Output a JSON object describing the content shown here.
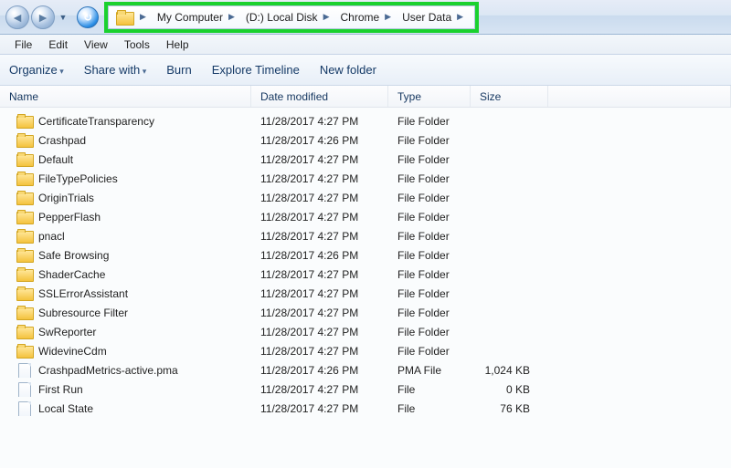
{
  "breadcrumb": {
    "segments": [
      "My Computer",
      "(D:) Local Disk",
      "Chrome",
      "User Data"
    ]
  },
  "menu": {
    "items": [
      "File",
      "Edit",
      "View",
      "Tools",
      "Help"
    ]
  },
  "toolbar": {
    "organize": "Organize",
    "share": "Share with",
    "burn": "Burn",
    "timeline": "Explore Timeline",
    "newfolder": "New folder"
  },
  "columns": {
    "name": "Name",
    "modified": "Date modified",
    "type": "Type",
    "size": "Size"
  },
  "files": [
    {
      "name": "CertificateTransparency",
      "modified": "11/28/2017 4:27 PM",
      "type": "File Folder",
      "size": "",
      "kind": "folder"
    },
    {
      "name": "Crashpad",
      "modified": "11/28/2017 4:26 PM",
      "type": "File Folder",
      "size": "",
      "kind": "folder"
    },
    {
      "name": "Default",
      "modified": "11/28/2017 4:27 PM",
      "type": "File Folder",
      "size": "",
      "kind": "folder"
    },
    {
      "name": "FileTypePolicies",
      "modified": "11/28/2017 4:27 PM",
      "type": "File Folder",
      "size": "",
      "kind": "folder"
    },
    {
      "name": "OriginTrials",
      "modified": "11/28/2017 4:27 PM",
      "type": "File Folder",
      "size": "",
      "kind": "folder"
    },
    {
      "name": "PepperFlash",
      "modified": "11/28/2017 4:27 PM",
      "type": "File Folder",
      "size": "",
      "kind": "folder"
    },
    {
      "name": "pnacl",
      "modified": "11/28/2017 4:27 PM",
      "type": "File Folder",
      "size": "",
      "kind": "folder"
    },
    {
      "name": "Safe Browsing",
      "modified": "11/28/2017 4:26 PM",
      "type": "File Folder",
      "size": "",
      "kind": "folder"
    },
    {
      "name": "ShaderCache",
      "modified": "11/28/2017 4:27 PM",
      "type": "File Folder",
      "size": "",
      "kind": "folder"
    },
    {
      "name": "SSLErrorAssistant",
      "modified": "11/28/2017 4:27 PM",
      "type": "File Folder",
      "size": "",
      "kind": "folder"
    },
    {
      "name": "Subresource Filter",
      "modified": "11/28/2017 4:27 PM",
      "type": "File Folder",
      "size": "",
      "kind": "folder"
    },
    {
      "name": "SwReporter",
      "modified": "11/28/2017 4:27 PM",
      "type": "File Folder",
      "size": "",
      "kind": "folder"
    },
    {
      "name": "WidevineCdm",
      "modified": "11/28/2017 4:27 PM",
      "type": "File Folder",
      "size": "",
      "kind": "folder"
    },
    {
      "name": "CrashpadMetrics-active.pma",
      "modified": "11/28/2017 4:26 PM",
      "type": "PMA File",
      "size": "1,024 KB",
      "kind": "file"
    },
    {
      "name": "First Run",
      "modified": "11/28/2017 4:27 PM",
      "type": "File",
      "size": "0 KB",
      "kind": "file"
    },
    {
      "name": "Local State",
      "modified": "11/28/2017 4:27 PM",
      "type": "File",
      "size": "76 KB",
      "kind": "file"
    }
  ]
}
